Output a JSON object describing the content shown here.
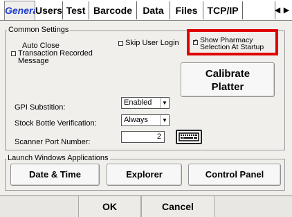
{
  "tabs": [
    "General",
    "Users",
    "Test",
    "Barcode",
    "Data",
    "Files",
    "TCP/IP"
  ],
  "tab_scroll": {
    "left": "◀",
    "right": "▶"
  },
  "common": {
    "title": "Common Settings",
    "auto_close_label_line1": "Auto Close",
    "auto_close_label_line2": "Transaction Recorded",
    "auto_close_label_line3": "Message",
    "skip_user_login": "Skip User Login",
    "show_pharmacy_line1": "Show Pharmacy",
    "show_pharmacy_line2": "Selection At Startup",
    "calibrate_line1": "Calibrate",
    "calibrate_line2": "Platter",
    "gpi_label": "GPI Substition:",
    "gpi_value": "Enabled",
    "stock_label": "Stock Bottle Verification:",
    "stock_value": "Always",
    "scanner_label": "Scanner Port Number:",
    "scanner_value": "2"
  },
  "launch": {
    "title": "Launch Windows Applications",
    "date_time": "Date & Time",
    "explorer": "Explorer",
    "control_panel": "Control Panel"
  },
  "footer": {
    "ok": "OK",
    "cancel": "Cancel"
  },
  "colors": {
    "active_tab": "#1f3cd0",
    "highlight": "#e00000"
  }
}
